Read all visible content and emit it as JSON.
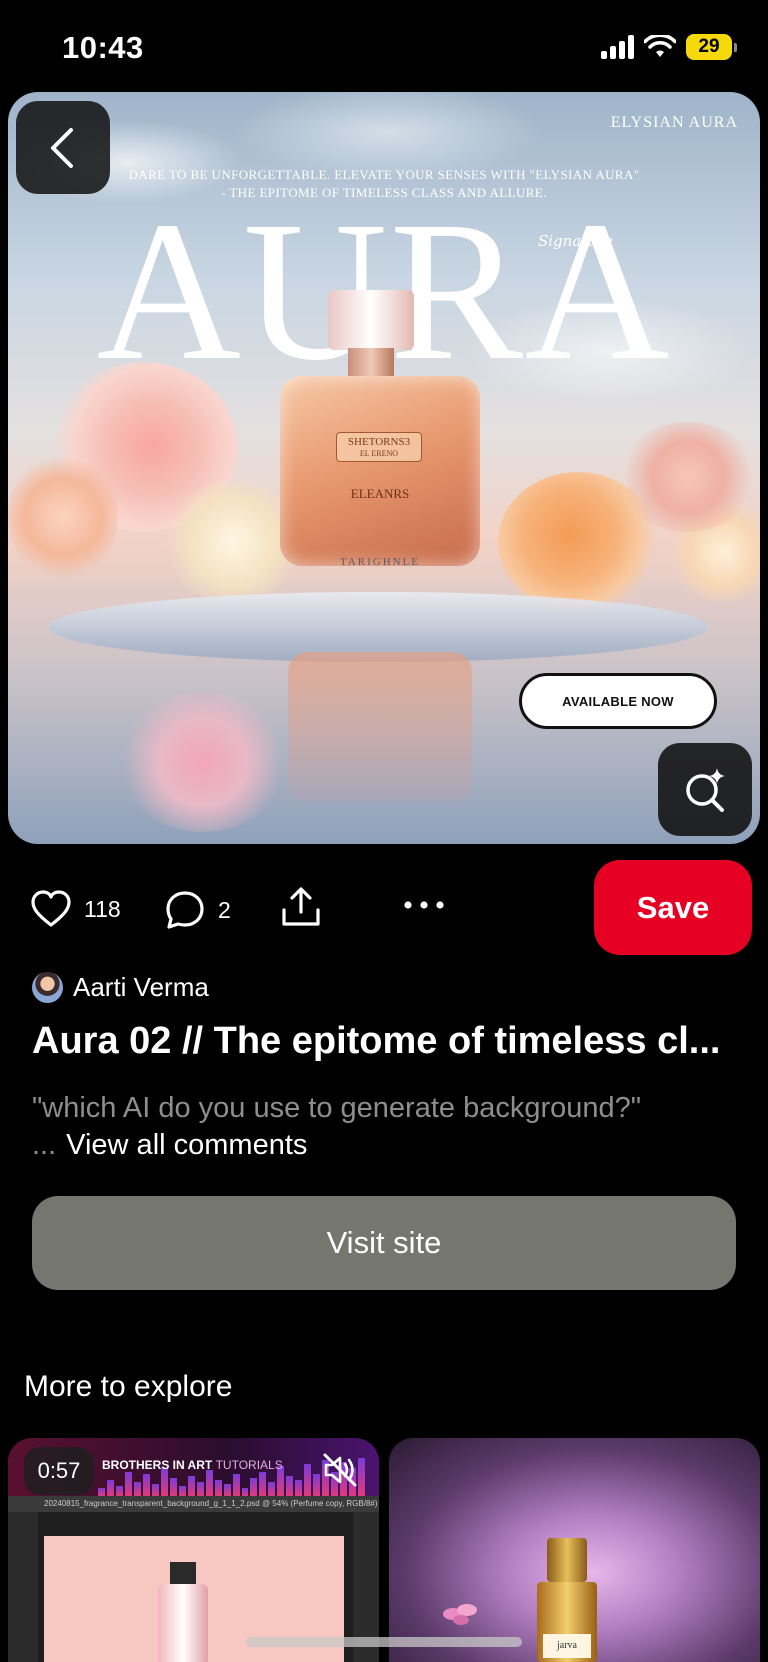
{
  "status_bar": {
    "time": "10:43",
    "battery": "29",
    "icons": [
      "cellular-signal-icon",
      "wifi-icon",
      "battery-icon"
    ]
  },
  "hero_image": {
    "brand": "ELYSIAN AURA",
    "tagline_line1": "DARE TO BE UNFORGETTABLE. ELEVATE YOUR SENSES WITH \"ELYSIAN AURA\"",
    "tagline_line2": "- THE EPITOME OF TIMELESS CLASS AND ALLURE.",
    "headline": "AURA",
    "signature": "Signature",
    "label_line1": "SHETORNS3",
    "label_line2": "EL ERENO",
    "bottle_name": "ELEANRS",
    "bottle_base": "TARIGHNLE",
    "pill": "AVAILABLE NOW"
  },
  "actions": {
    "likes": "118",
    "comments": "2",
    "save_label": "Save",
    "icons": [
      "heart-icon",
      "comment-icon",
      "share-icon",
      "more-icon"
    ]
  },
  "pin": {
    "author": "Aarti Verma",
    "title": "Aura 02 // The epitome of timeless cl...",
    "comment_preview": "\"which AI do you use to generate background?\" ...",
    "view_all": "View all comments",
    "visit_label": "Visit site"
  },
  "explore": {
    "title": "More to explore",
    "cards": [
      {
        "duration": "0:57",
        "channel": "BROTHERS IN ART",
        "channel_suffix": "TUTORIALS",
        "file_tab": "20240815_fragrance_transparent_background_g_1_1_2.psd @ 54% (Perfume copy, RGB/8#) *"
      },
      {
        "bottle_label": "jarva"
      }
    ]
  },
  "colors": {
    "save": "#e60023",
    "visit": "#767670",
    "background": "#000000",
    "muted_text": "#8e8e8e"
  }
}
